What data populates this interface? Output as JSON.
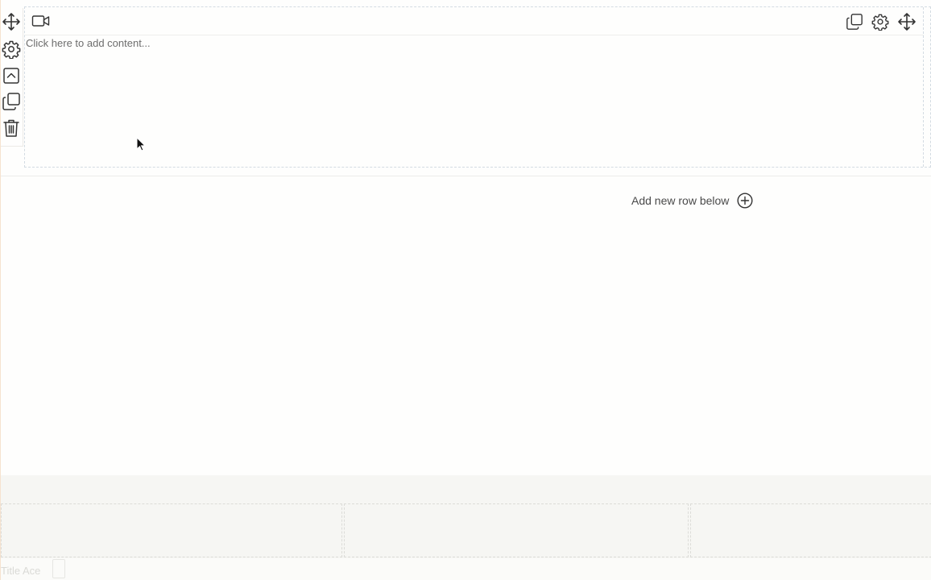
{
  "row_toolbar": {
    "tools": [
      {
        "name": "move-icon"
      },
      {
        "name": "gear-icon"
      },
      {
        "name": "collapse-icon"
      },
      {
        "name": "duplicate-icon"
      },
      {
        "name": "trash-icon"
      }
    ]
  },
  "module": {
    "type_icon": "video-camera-icon",
    "placeholder": "Click here to add content...",
    "actions": [
      {
        "name": "duplicate-icon"
      },
      {
        "name": "gear-icon"
      },
      {
        "name": "move-icon"
      }
    ]
  },
  "add_row": {
    "label": "Add new row below",
    "icon": "plus-circle-icon"
  },
  "footer": {
    "faded_text": "Title Ace"
  },
  "colors": {
    "background": "#fefefd",
    "footer_background": "#f6f6f3",
    "dashed_border": "#d3dbe2",
    "icon_stroke": "#333333"
  }
}
